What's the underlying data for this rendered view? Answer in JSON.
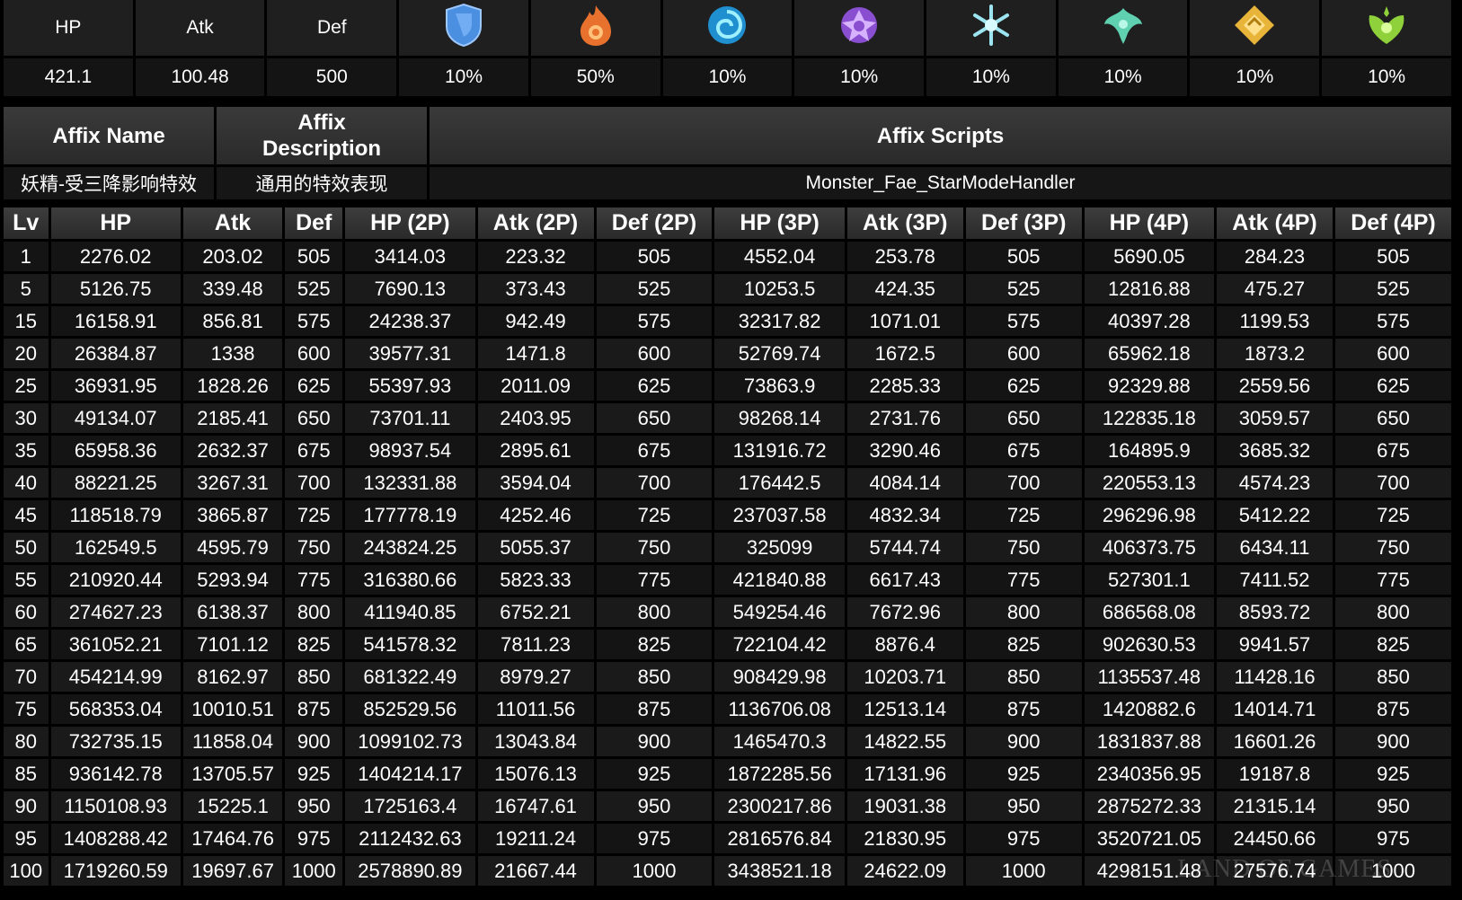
{
  "stats": {
    "headers": [
      "HP",
      "Atk",
      "Def"
    ],
    "values": [
      "421.1",
      "100.48",
      "500"
    ],
    "resistances": [
      {
        "icon": "physical-shield-icon",
        "color": "#4a8fe0",
        "value": "10%"
      },
      {
        "icon": "pyro-flame-icon",
        "color": "#e8722d",
        "value": "50%"
      },
      {
        "icon": "hydro-swirl-icon",
        "color": "#2fb5e8",
        "value": "10%"
      },
      {
        "icon": "electro-icon",
        "color": "#a66be8",
        "value": "10%"
      },
      {
        "icon": "cryo-snowflake-icon",
        "color": "#9ce4ef",
        "value": "10%"
      },
      {
        "icon": "anemo-icon",
        "color": "#5fd1b0",
        "value": "10%"
      },
      {
        "icon": "geo-icon",
        "color": "#e8b43a",
        "value": "10%"
      },
      {
        "icon": "dendro-icon",
        "color": "#8fd13a",
        "value": "10%"
      }
    ]
  },
  "affix": {
    "headers": {
      "name": "Affix Name",
      "description_line1": "Affix",
      "description_line2": "Description",
      "scripts": "Affix Scripts"
    },
    "row": {
      "name": "妖精-受三降影响特效",
      "description": "通用的特效表现",
      "scripts": "Monster_Fae_StarModeHandler"
    }
  },
  "table": {
    "columns": [
      "Lv",
      "HP",
      "Atk",
      "Def",
      "HP (2P)",
      "Atk (2P)",
      "Def (2P)",
      "HP (3P)",
      "Atk (3P)",
      "Def (3P)",
      "HP (4P)",
      "Atk (4P)",
      "Def (4P)"
    ],
    "rows": [
      [
        "1",
        "2276.02",
        "203.02",
        "505",
        "3414.03",
        "223.32",
        "505",
        "4552.04",
        "253.78",
        "505",
        "5690.05",
        "284.23",
        "505"
      ],
      [
        "5",
        "5126.75",
        "339.48",
        "525",
        "7690.13",
        "373.43",
        "525",
        "10253.5",
        "424.35",
        "525",
        "12816.88",
        "475.27",
        "525"
      ],
      [
        "15",
        "16158.91",
        "856.81",
        "575",
        "24238.37",
        "942.49",
        "575",
        "32317.82",
        "1071.01",
        "575",
        "40397.28",
        "1199.53",
        "575"
      ],
      [
        "20",
        "26384.87",
        "1338",
        "600",
        "39577.31",
        "1471.8",
        "600",
        "52769.74",
        "1672.5",
        "600",
        "65962.18",
        "1873.2",
        "600"
      ],
      [
        "25",
        "36931.95",
        "1828.26",
        "625",
        "55397.93",
        "2011.09",
        "625",
        "73863.9",
        "2285.33",
        "625",
        "92329.88",
        "2559.56",
        "625"
      ],
      [
        "30",
        "49134.07",
        "2185.41",
        "650",
        "73701.11",
        "2403.95",
        "650",
        "98268.14",
        "2731.76",
        "650",
        "122835.18",
        "3059.57",
        "650"
      ],
      [
        "35",
        "65958.36",
        "2632.37",
        "675",
        "98937.54",
        "2895.61",
        "675",
        "131916.72",
        "3290.46",
        "675",
        "164895.9",
        "3685.32",
        "675"
      ],
      [
        "40",
        "88221.25",
        "3267.31",
        "700",
        "132331.88",
        "3594.04",
        "700",
        "176442.5",
        "4084.14",
        "700",
        "220553.13",
        "4574.23",
        "700"
      ],
      [
        "45",
        "118518.79",
        "3865.87",
        "725",
        "177778.19",
        "4252.46",
        "725",
        "237037.58",
        "4832.34",
        "725",
        "296296.98",
        "5412.22",
        "725"
      ],
      [
        "50",
        "162549.5",
        "4595.79",
        "750",
        "243824.25",
        "5055.37",
        "750",
        "325099",
        "5744.74",
        "750",
        "406373.75",
        "6434.11",
        "750"
      ],
      [
        "55",
        "210920.44",
        "5293.94",
        "775",
        "316380.66",
        "5823.33",
        "775",
        "421840.88",
        "6617.43",
        "775",
        "527301.1",
        "7411.52",
        "775"
      ],
      [
        "60",
        "274627.23",
        "6138.37",
        "800",
        "411940.85",
        "6752.21",
        "800",
        "549254.46",
        "7672.96",
        "800",
        "686568.08",
        "8593.72",
        "800"
      ],
      [
        "65",
        "361052.21",
        "7101.12",
        "825",
        "541578.32",
        "7811.23",
        "825",
        "722104.42",
        "8876.4",
        "825",
        "902630.53",
        "9941.57",
        "825"
      ],
      [
        "70",
        "454214.99",
        "8162.97",
        "850",
        "681322.49",
        "8979.27",
        "850",
        "908429.98",
        "10203.71",
        "850",
        "1135537.48",
        "11428.16",
        "850"
      ],
      [
        "75",
        "568353.04",
        "10010.51",
        "875",
        "852529.56",
        "11011.56",
        "875",
        "1136706.08",
        "12513.14",
        "875",
        "1420882.6",
        "14014.71",
        "875"
      ],
      [
        "80",
        "732735.15",
        "11858.04",
        "900",
        "1099102.73",
        "13043.84",
        "900",
        "1465470.3",
        "14822.55",
        "900",
        "1831837.88",
        "16601.26",
        "900"
      ],
      [
        "85",
        "936142.78",
        "13705.57",
        "925",
        "1404214.17",
        "15076.13",
        "925",
        "1872285.56",
        "17131.96",
        "925",
        "2340356.95",
        "19187.8",
        "925"
      ],
      [
        "90",
        "1150108.93",
        "15225.1",
        "950",
        "1725163.4",
        "16747.61",
        "950",
        "2300217.86",
        "19031.38",
        "950",
        "2875272.33",
        "21315.14",
        "950"
      ],
      [
        "95",
        "1408288.42",
        "17464.76",
        "975",
        "2112432.63",
        "19211.24",
        "975",
        "2816576.84",
        "21830.95",
        "975",
        "3520721.05",
        "24450.66",
        "975"
      ],
      [
        "100",
        "1719260.59",
        "19697.67",
        "1000",
        "2578890.89",
        "21667.44",
        "1000",
        "3438521.18",
        "24622.09",
        "1000",
        "4298151.48",
        "27576.74",
        "1000"
      ]
    ]
  },
  "watermark": "LAND OF GAMES"
}
